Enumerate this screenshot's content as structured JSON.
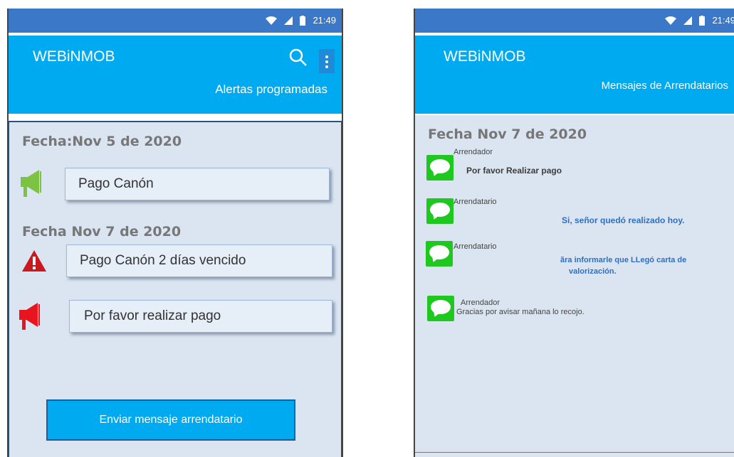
{
  "status": {
    "time": "21:49"
  },
  "left": {
    "app_title": "WEBiNMOB",
    "subtitle": "Alertas programadas",
    "icons": {
      "search": "search-icon",
      "menu": "more-vert-icon"
    },
    "date1": "Fecha:Nov 5 de 2020",
    "alert1": "Pago Canón",
    "date2": "Fecha Nov 7 de 2020",
    "alert2": "Pago Canón 2 días vencido",
    "alert3": "Por  favor  realizar pago",
    "send_button": "Enviar mensaje arrendatario",
    "colors": {
      "accent": "#00aaf0",
      "statusbar": "#3b78c8",
      "content_bg": "#dbe5f1",
      "green_megaphone": "#7cc243",
      "red_megaphone": "#e8141e",
      "warning": "#c8191e"
    }
  },
  "right": {
    "app_title": "WEBiNMOB",
    "subtitle": "Mensajes de Arrendatarios",
    "date": "Fecha Nov 7 de 2020",
    "messages": [
      {
        "sender": "Arrendador",
        "text": "Por favor Realizar pago"
      },
      {
        "sender": "Arrendatario",
        "text": "Si, señor quedó realizado hoy."
      },
      {
        "sender": "Arrendatario",
        "text_line1": "ãra informarle que LLegó carta de",
        "text_line2": "valorización."
      },
      {
        "sender": "Arrendador",
        "text": "Gracias por avisar mañana lo recojo."
      }
    ],
    "colors": {
      "message_icon": "#1ec81e",
      "blue_text": "#2f6fc0"
    }
  }
}
